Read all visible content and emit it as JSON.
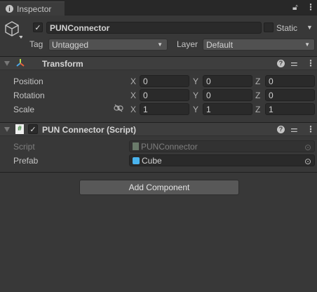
{
  "tab": {
    "title": "Inspector",
    "icon": "info-icon"
  },
  "object": {
    "active": true,
    "name": "PUNConnector",
    "static_label": "Static",
    "static": false,
    "tag_label": "Tag",
    "tag": "Untagged",
    "layer_label": "Layer",
    "layer": "Default"
  },
  "transform": {
    "title": "Transform",
    "rows": [
      {
        "label": "Position",
        "x": "0",
        "y": "0",
        "z": "0"
      },
      {
        "label": "Rotation",
        "x": "0",
        "y": "0",
        "z": "0"
      },
      {
        "label": "Scale",
        "x": "1",
        "y": "1",
        "z": "1"
      }
    ],
    "axes": {
      "x": "X",
      "y": "Y",
      "z": "Z"
    }
  },
  "script_component": {
    "title": "PUN Connector (Script)",
    "enabled": true,
    "script_label": "Script",
    "script_value": "PUNConnector",
    "prefab_label": "Prefab",
    "prefab_value": "Cube"
  },
  "add_component_label": "Add Component",
  "colors": {
    "background": "#383838",
    "field": "#2a2a2a",
    "header": "#3e3e3e"
  }
}
